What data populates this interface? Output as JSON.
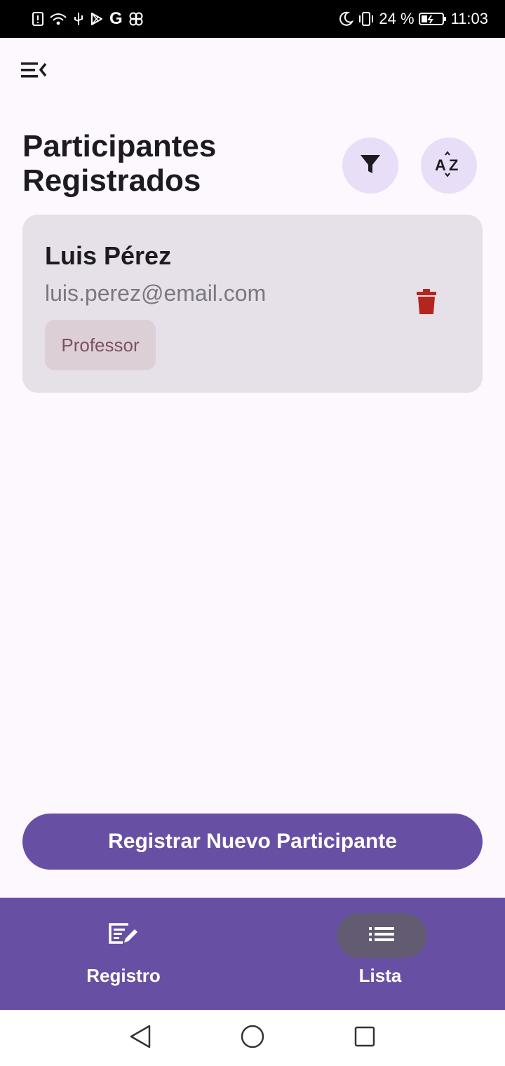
{
  "status_bar": {
    "battery": "24 %",
    "time": "11:03",
    "carrier_letter": "G"
  },
  "page": {
    "title": "Participantes Registrados"
  },
  "participants": [
    {
      "name": "Luis Pérez",
      "email": "luis.perez@email.com",
      "role": "Professor"
    }
  ],
  "actions": {
    "register_button": "Registrar Nuevo Participante"
  },
  "bottom_nav": {
    "items": [
      {
        "label": "Registro",
        "icon": "edit-note-icon",
        "selected": false
      },
      {
        "label": "Lista",
        "icon": "list-icon",
        "selected": true
      }
    ]
  },
  "colors": {
    "primary": "#6750a4",
    "secondary_container": "#e8def8",
    "card_bg": "#e6e0e9",
    "delete": "#b3261e",
    "chip_bg": "#dcd0d6",
    "chip_text": "#7d5260"
  }
}
